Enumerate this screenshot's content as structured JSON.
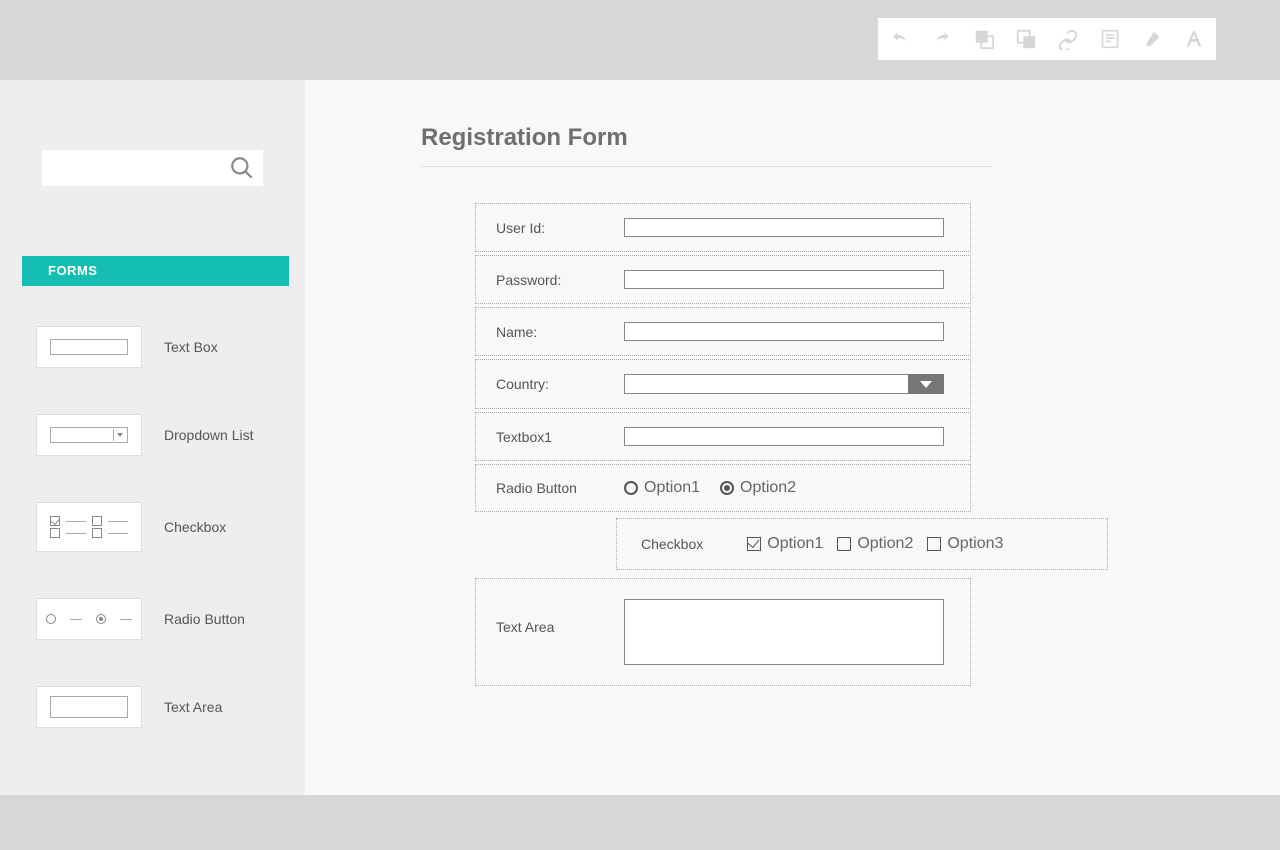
{
  "toolbar": {
    "undo": "undo",
    "redo": "redo",
    "bringfront": "bring-front",
    "sendback": "send-back",
    "link": "link",
    "note": "note",
    "style": "style",
    "font": "font"
  },
  "sidebar": {
    "category": "FORMS",
    "items": [
      {
        "label": "Text Box"
      },
      {
        "label": "Dropdown List"
      },
      {
        "label": "Checkbox"
      },
      {
        "label": "Radio Button"
      },
      {
        "label": "Text Area"
      }
    ]
  },
  "form": {
    "title": "Registration Form",
    "fields": {
      "userid": {
        "label": "User Id:"
      },
      "password": {
        "label": "Password:"
      },
      "name": {
        "label": "Name:"
      },
      "country": {
        "label": "Country:"
      },
      "textbox1": {
        "label": "Textbox1"
      },
      "radio": {
        "label": "Radio Button",
        "options": [
          "Option1",
          "Option2"
        ],
        "selected": 1
      },
      "checkbox": {
        "label": "Checkbox",
        "options": [
          "Option1",
          "Option2",
          "Option3"
        ],
        "checked": [
          0
        ]
      },
      "textarea": {
        "label": "Text Area"
      }
    }
  }
}
